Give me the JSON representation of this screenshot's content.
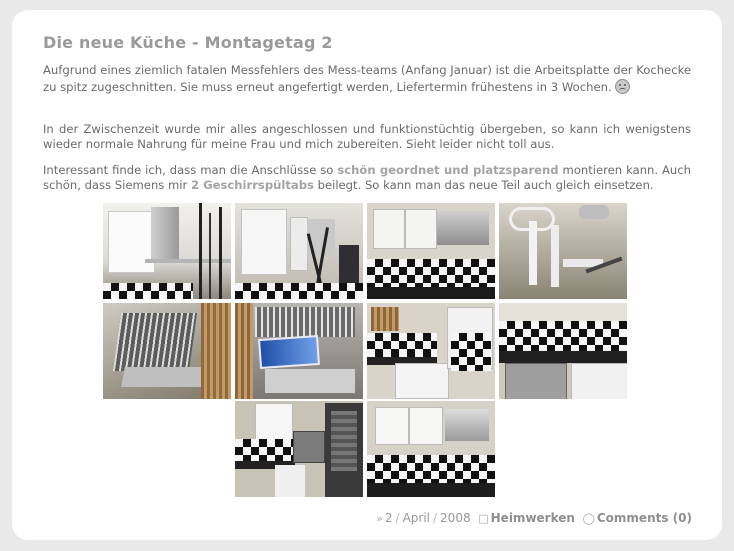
{
  "post": {
    "title": "Die neue Küche - Montagetag 2",
    "p1": "Aufgrund eines ziemlich fatalen Messfehlers des Mess-teams (Anfang Januar) ist die Arbeitsplatte der Kochecke zu spitz zugeschnitten. Sie muss erneut angefertigt werden, Liefertermin frühestens in 3 Wochen.",
    "p2": "In der Zwischenzeit wurde mir alles angeschlossen und funktionstüchtig übergeben, so kann ich wenigstens wieder normale Nahrung für meine Frau und mich zubereiten. Sieht leider nicht toll aus.",
    "p3_a": "Interessant finde ich, dass man die Anschlüsse so ",
    "p3_kw1": "schön geordnet und platzsparend",
    "p3_b": " montieren kann. Auch schön, dass Siemens mir ",
    "p3_kw2": "2 Geschirrspültabs",
    "p3_c": " beilegt. So kann man das neue Teil auch gleich einsetzen."
  },
  "gallery": {
    "photos": [
      "kitchen-hood-photo",
      "kitchen-shelf-photo",
      "kitchen-cabinets-photo",
      "sink-pipes-photo",
      "dishwasher-open-photo",
      "dishwasher-tabs-photo",
      "kitchen-corner-photo",
      "oven-counter-photo",
      "kitchen-oven-column-photo",
      "kitchen-overview-photo"
    ]
  },
  "footer": {
    "day": "2",
    "month": "April",
    "year": "2008",
    "separator": "/",
    "category": "Heimwerken",
    "comments": "Comments (0)"
  },
  "icons": {
    "date": "double-chevron-icon",
    "category": "document-icon",
    "comments": "speech-bubble-icon",
    "emoticon": "sad-face-icon"
  }
}
